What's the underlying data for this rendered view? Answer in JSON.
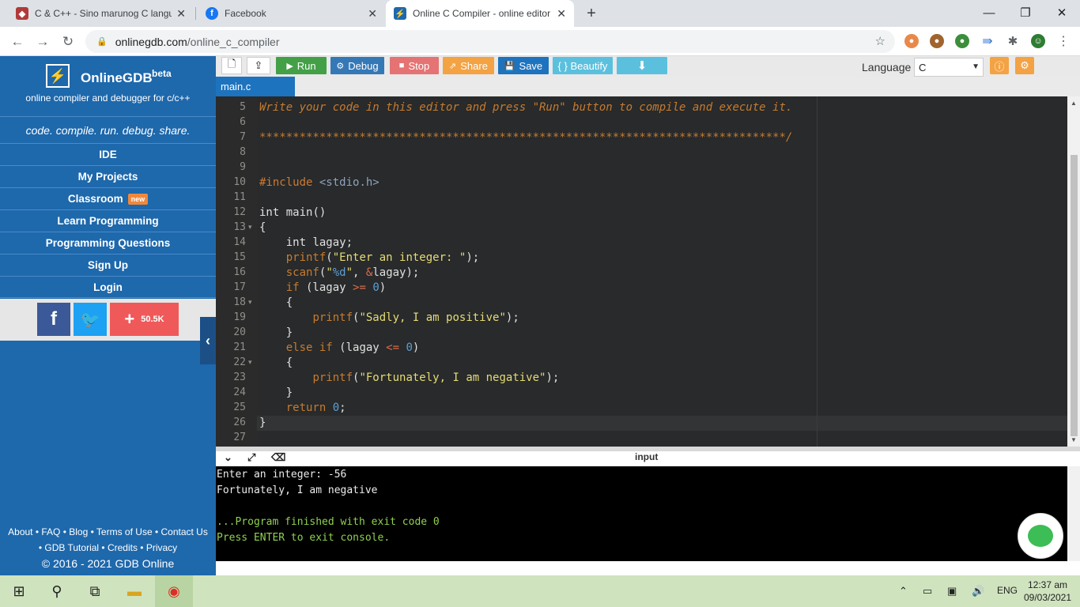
{
  "browser": {
    "tabs": [
      {
        "title": "C & C++ - Sino marunog C langu",
        "close": "✕"
      },
      {
        "title": "Facebook",
        "close": "✕"
      },
      {
        "title": "Online C Compiler - online editor",
        "close": "✕"
      }
    ],
    "new_tab": "+",
    "window_controls": {
      "minimize": "—",
      "maximize": "❐",
      "close": "✕"
    },
    "url_host": "onlinegdb.com",
    "url_path": "/online_c_compiler"
  },
  "sidebar": {
    "brand": "OnlineGDB",
    "brand_sup": "beta",
    "tagline": "online compiler and debugger for c/c++",
    "motto": "code. compile. run. debug. share.",
    "nav": [
      {
        "label": "IDE"
      },
      {
        "label": "My Projects"
      },
      {
        "label": "Classroom",
        "badge": "new"
      },
      {
        "label": "Learn Programming"
      },
      {
        "label": "Programming Questions"
      },
      {
        "label": "Sign Up"
      },
      {
        "label": "Login"
      }
    ],
    "share": {
      "facebook": "f",
      "twitter": "t",
      "count": "50.5K"
    },
    "footer_line1": "About • FAQ • Blog • Terms of Use • Contact Us",
    "footer_line2": "• GDB Tutorial • Credits • Privacy",
    "copyright": "© 2016 - 2021 GDB Online"
  },
  "toolbar": {
    "run": "Run",
    "debug": "Debug",
    "stop": "Stop",
    "share": "Share",
    "save": "Save",
    "beautify": "{ } Beautify",
    "language_label": "Language",
    "language_value": "C"
  },
  "file_tab": "main.c",
  "editor": {
    "lines": [
      {
        "n": "5",
        "text": "Write your code in this editor and press \"Run\" button to compile and execute it."
      },
      {
        "n": "6",
        "text": ""
      },
      {
        "n": "7",
        "text": "*******************************************************************************/"
      },
      {
        "n": "8",
        "text": ""
      },
      {
        "n": "9",
        "text": ""
      },
      {
        "n": "10",
        "text": "#include <stdio.h>"
      },
      {
        "n": "11",
        "text": ""
      },
      {
        "n": "12",
        "text": "int main()"
      },
      {
        "n": "13",
        "text": "{"
      },
      {
        "n": "14",
        "text": "    int lagay;"
      },
      {
        "n": "15",
        "text": "    printf(\"Enter an integer: \");"
      },
      {
        "n": "16",
        "text": "    scanf(\"%d\", &lagay);"
      },
      {
        "n": "17",
        "text": "    if (lagay >= 0)"
      },
      {
        "n": "18",
        "text": "    {"
      },
      {
        "n": "19",
        "text": "        printf(\"Sadly, I am positive\");"
      },
      {
        "n": "20",
        "text": "    }"
      },
      {
        "n": "21",
        "text": "    else if (lagay <= 0)"
      },
      {
        "n": "22",
        "text": "    {"
      },
      {
        "n": "23",
        "text": "        printf(\"Fortunately, I am negative\");"
      },
      {
        "n": "24",
        "text": "    }"
      },
      {
        "n": "25",
        "text": "    return 0;"
      },
      {
        "n": "26",
        "text": "}"
      },
      {
        "n": "27",
        "text": ""
      }
    ]
  },
  "console": {
    "header_label": "input",
    "lines": [
      "Enter an integer: -56",
      "Fortunately, I am negative",
      "",
      "...Program finished with exit code 0",
      "Press ENTER to exit console."
    ]
  },
  "taskbar": {
    "language": "ENG",
    "time": "12:37 am",
    "date": "09/03/2021"
  },
  "colors": {
    "sidebar": "#1e68ac",
    "run": "#43a047",
    "debug": "#3578b6",
    "stop": "#e57373",
    "share": "#f3a244",
    "save": "#1e73be",
    "beautify": "#5bc0de",
    "download": "#5bc0de"
  }
}
